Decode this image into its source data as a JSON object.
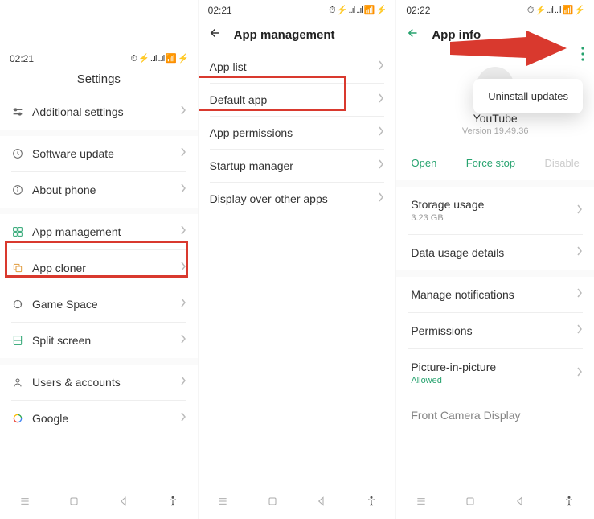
{
  "panel1": {
    "time": "02:21",
    "status_icons": "⏱ ⚡ ..ıl ..ıl 📶 ⚡",
    "title": "Settings",
    "items": [
      {
        "label": "Additional settings"
      },
      {
        "label": "Software update"
      },
      {
        "label": "About phone"
      },
      {
        "label": "App management",
        "highlight": true
      },
      {
        "label": "App cloner"
      },
      {
        "label": "Game Space"
      },
      {
        "label": "Split screen"
      },
      {
        "label": "Users & accounts"
      },
      {
        "label": "Google"
      }
    ]
  },
  "panel2": {
    "time": "02:21",
    "status_icons": "⏱ ⚡ ..ıl ..ıl 📶 ⚡",
    "header": "App management",
    "items": [
      {
        "label": "App list",
        "highlight": true
      },
      {
        "label": "Default app"
      },
      {
        "label": "App permissions"
      },
      {
        "label": "Startup manager"
      },
      {
        "label": "Display over other apps"
      }
    ]
  },
  "panel3": {
    "time": "02:22",
    "status_icons": "⏱ ⚡ ..ıl ..ıl 📶 ⚡",
    "header": "App info",
    "popup": "Uninstall updates",
    "app_name": "YouTube",
    "app_version": "Version 19.49.36",
    "actions": {
      "open": "Open",
      "force_stop": "Force stop",
      "disable": "Disable"
    },
    "rows": {
      "storage_title": "Storage usage",
      "storage_sub": "3.23 GB",
      "data_usage": "Data usage details",
      "notifications": "Manage notifications",
      "permissions": "Permissions",
      "pip_title": "Picture-in-picture",
      "pip_sub": "Allowed",
      "camera": "Front Camera Display"
    }
  }
}
